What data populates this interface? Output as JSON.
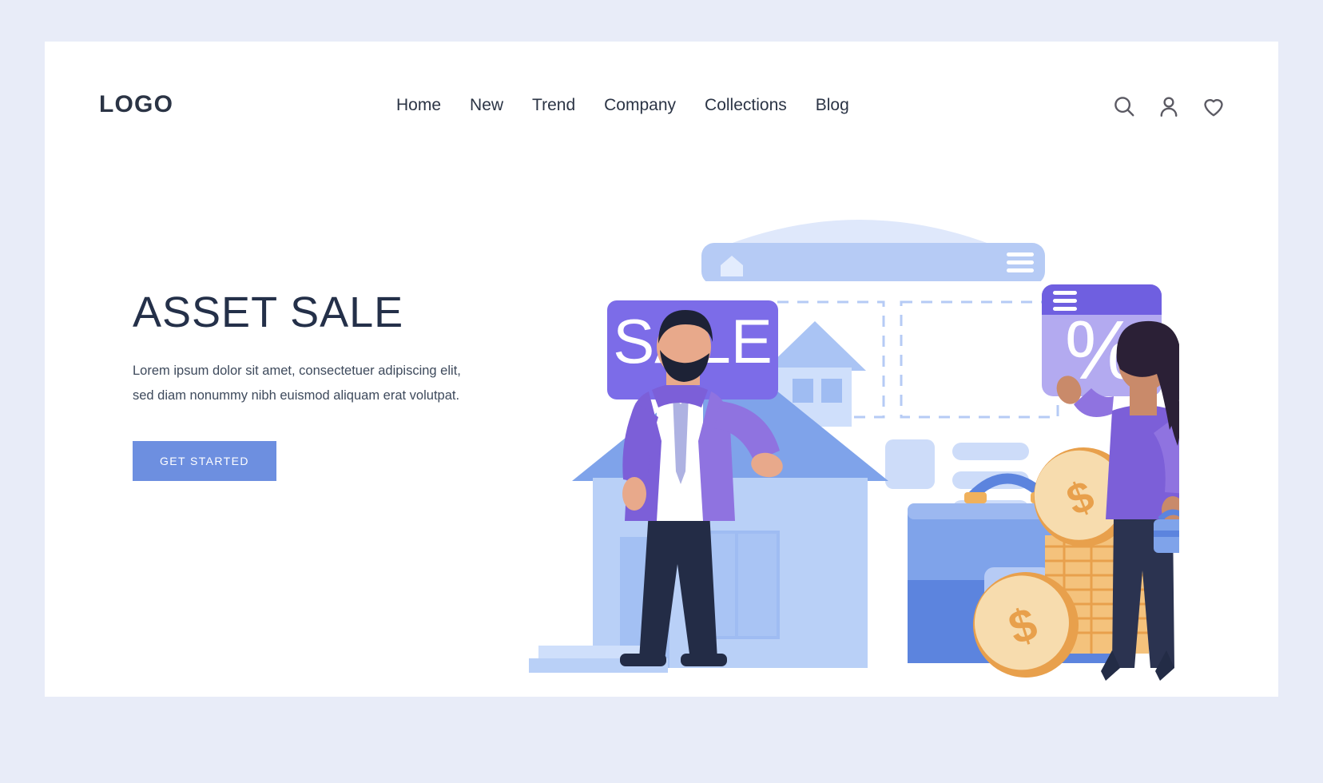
{
  "brand": {
    "logo_text": "LOGO"
  },
  "nav": {
    "links": [
      {
        "label": "Home"
      },
      {
        "label": "New"
      },
      {
        "label": "Trend"
      },
      {
        "label": "Company"
      },
      {
        "label": "Collections"
      },
      {
        "label": "Blog"
      }
    ],
    "icons": [
      {
        "name": "search-icon"
      },
      {
        "name": "user-icon"
      },
      {
        "name": "heart-icon"
      }
    ]
  },
  "hero": {
    "headline": "ASSET SALE",
    "paragraph": "Lorem ipsum dolor sit amet, consectetuer adipiscing elit, sed diam nonummy nibh euismod aliquam erat volutpat.",
    "cta_label": "GET STARTED"
  },
  "illustration": {
    "sale_banner_text": "SALE",
    "percent_card_text": "%",
    "coin_symbol": "$",
    "elements": [
      "browser-window",
      "house",
      "sale-banner",
      "percent-card",
      "briefcase",
      "coin-stack",
      "man-character",
      "woman-character"
    ]
  },
  "colors": {
    "page_background": "#e8ecf8",
    "card_background": "#ffffff",
    "text_dark": "#2b3445",
    "headline": "#243049",
    "cta_background": "#6d8fe0",
    "accent_purple": "#7c6ce8",
    "accent_purple_light": "#b3aaf0",
    "accent_blue": "#6d8fe0",
    "accent_blue_light": "#b6cbf5",
    "coin_gold": "#f0b15c"
  }
}
